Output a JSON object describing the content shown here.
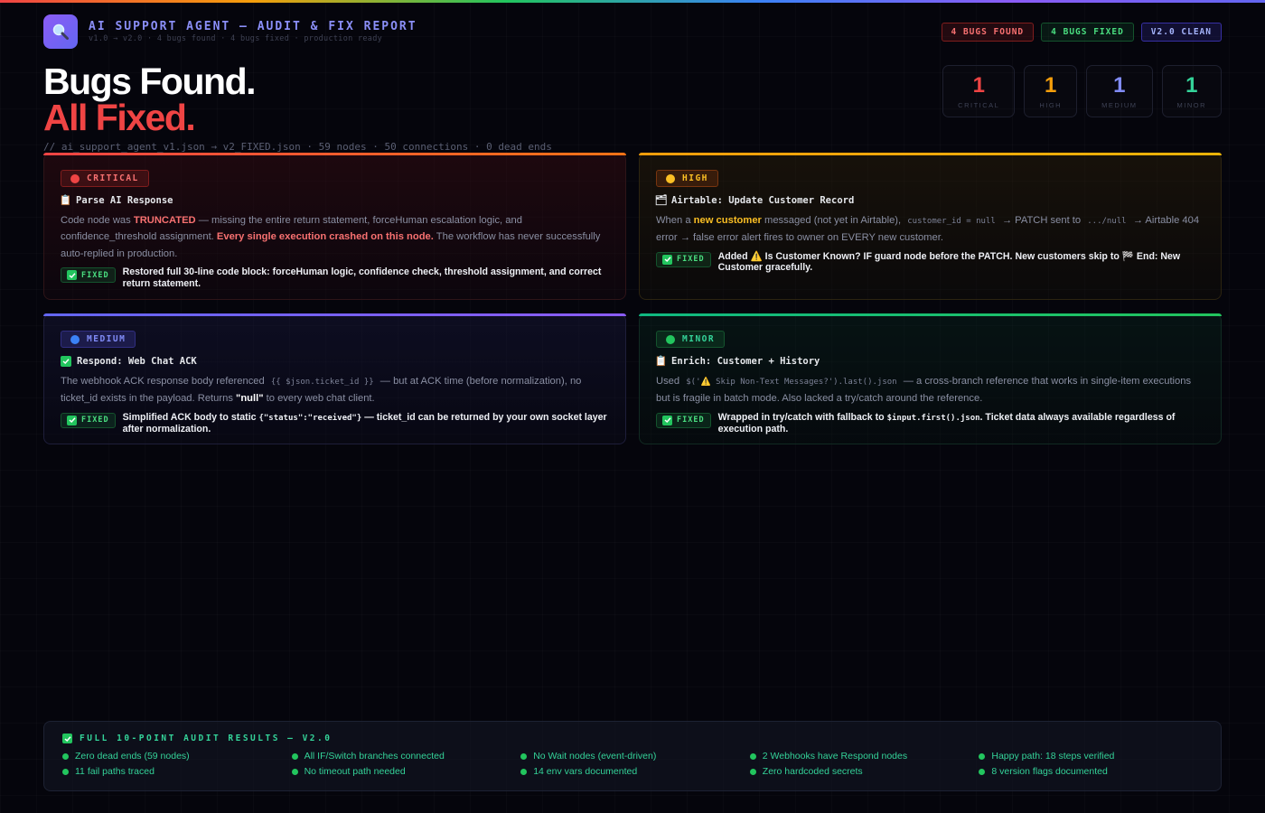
{
  "header": {
    "title": "AI SUPPORT AGENT — AUDIT & FIX REPORT",
    "subtitle": "v1.0 → v2.0 · 4 bugs found · 4 bugs fixed · production ready",
    "logo_icon": "magnifier-icon"
  },
  "badges": [
    "4 BUGS FOUND",
    "4 BUGS FIXED",
    "V2.0 CLEAN"
  ],
  "hero": {
    "line1": "Bugs Found.",
    "line2": "All Fixed.",
    "path": "// ai_support_agent_v1.json → v2_FIXED.json · 59 nodes · 50 connections · 0 dead ends"
  },
  "stats": [
    {
      "count": "1",
      "label": "CRITICAL",
      "color": "#ef4444"
    },
    {
      "count": "1",
      "label": "HIGH",
      "color": "#f59e0b"
    },
    {
      "count": "1",
      "label": "MEDIUM",
      "color": "#818cf8"
    },
    {
      "count": "1",
      "label": "MINOR",
      "color": "#34d399"
    }
  ],
  "cards": {
    "critical": {
      "severity": "CRITICAL",
      "node": "Parse AI Response",
      "node_icon": "clipboard-icon",
      "desc_1": "Code node was ",
      "desc_hl_1": "TRUNCATED",
      "desc_2": " — missing the entire return statement, forceHuman escalation logic, and confidence_threshold assignment. ",
      "desc_hl_2": "Every single execution crashed on this node.",
      "desc_3": " The workflow has never successfully auto-replied in production.",
      "fix_label": "FIXED",
      "fix": "Restored full 30-line code block: forceHuman logic, confidence check, threshold assignment, and correct return statement."
    },
    "high": {
      "severity": "HIGH",
      "node": "Airtable: Update Customer Record",
      "node_icon": "folder-icon",
      "desc_1": "When a ",
      "desc_hl_1": "new customer",
      "desc_2": " messaged (not yet in Airtable), ",
      "code_1": "customer_id = null",
      "desc_3": " → PATCH sent to ",
      "code_2": ".../null",
      "desc_4": " → Airtable 404 error → false error alert fires to owner on EVERY new customer.",
      "fix_label": "FIXED",
      "fix": "Added ⚠️ Is Customer Known? IF guard node before the PATCH. New customers skip to 🏁 End: New Customer gracefully."
    },
    "medium": {
      "severity": "MEDIUM",
      "node": "Respond: Web Chat ACK",
      "node_icon": "check-box-icon",
      "desc_1": "The webhook ACK response body referenced ",
      "code_1": "{{ $json.ticket_id }}",
      "desc_2": " — but at ACK time (before normalization), no ticket_id exists in the payload. Returns ",
      "desc_hl_1": "\"null\"",
      "desc_3": " to every web chat client.",
      "fix_label": "FIXED",
      "fix_1": "Simplified ACK body to static ",
      "fix_code": "{\"status\":\"received\"}",
      "fix_2": " — ticket_id can be returned by your own socket layer after normalization."
    },
    "minor": {
      "severity": "MINOR",
      "node": "Enrich: Customer + History",
      "node_icon": "clipboard-icon",
      "desc_1": "Used ",
      "code_1": "$('⚠️ Skip Non-Text Messages?').last().json",
      "desc_2": " — a cross-branch reference that works in single-item executions but is fragile in batch mode. Also lacked a try/catch around the reference.",
      "fix_label": "FIXED",
      "fix_1": "Wrapped in try/catch with fallback to ",
      "fix_code": "$input.first().json",
      "fix_2": ". Ticket data always available regardless of execution path."
    }
  },
  "results": {
    "title": "FULL 10-POINT AUDIT RESULTS — V2.0",
    "items": [
      "Zero dead ends (59 nodes)",
      "All IF/Switch branches connected",
      "No Wait nodes (event-driven)",
      "2 Webhooks have Respond nodes",
      "Happy path: 18 steps verified",
      "11 fail paths traced",
      "No timeout path needed",
      "14 env vars documented",
      "Zero hardcoded secrets",
      "8 version flags documented"
    ]
  }
}
